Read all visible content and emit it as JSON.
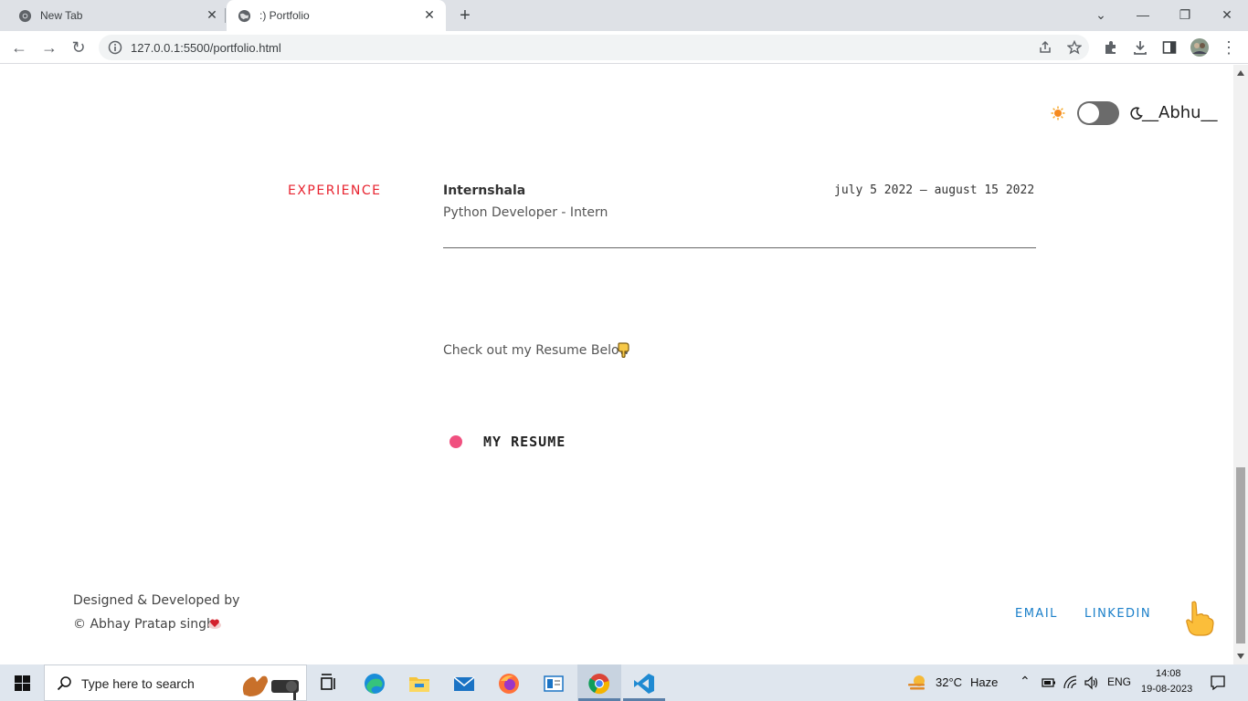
{
  "browser": {
    "tabs": [
      {
        "title": "New Tab",
        "icon": "chrome-icon",
        "active": false
      },
      {
        "title": ":) Portfolio",
        "icon": "globe-icon",
        "active": true
      }
    ],
    "url": "127.0.0.1:5500/portfolio.html"
  },
  "header": {
    "brand": "__Abhu__"
  },
  "experience": {
    "section_label": "EXPERIENCE",
    "company": "Internshala",
    "role": "Python Developer - Intern",
    "dates": "july 5 2022 – august 15 2022"
  },
  "resume": {
    "note": "Check out my Resume Below",
    "button_label": "MY RESUME",
    "dot_color": "#f0507f"
  },
  "footer": {
    "credit_line1": "Designed & Developed by",
    "credit_line2": "© Abhay Pratap singh",
    "links": [
      "EMAIL",
      "LINKEDIN"
    ],
    "link_color": "#1a7fc9"
  },
  "taskbar": {
    "search_placeholder": "Type here to search",
    "weather_temp": "32°C",
    "weather_desc": "Haze",
    "language": "ENG",
    "time": "14:08",
    "date": "19-08-2023"
  },
  "colors": {
    "accent_red": "#e8232f"
  }
}
